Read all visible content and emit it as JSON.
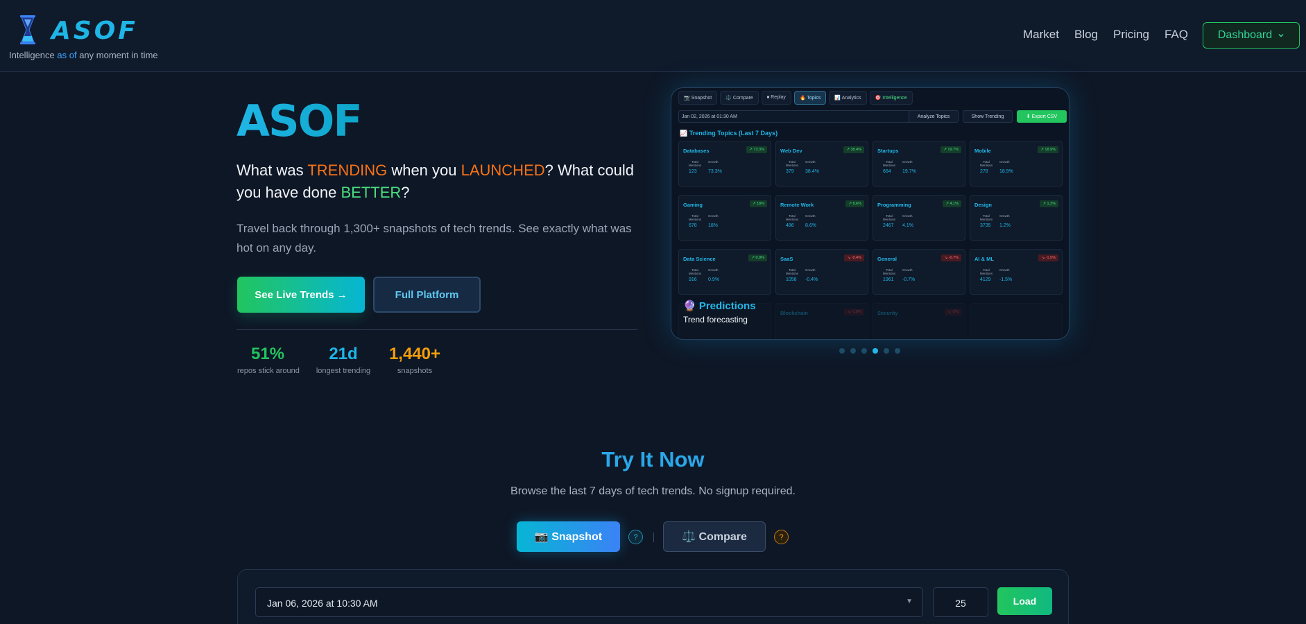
{
  "nav": {
    "brand": "ASOF",
    "tagline_pre": "Intelligence ",
    "tagline_hl": "as of",
    "tagline_post": " any moment in time",
    "links": [
      "Market",
      "Blog",
      "Pricing",
      "FAQ"
    ],
    "dashboard_label": "Dashboard"
  },
  "hero": {
    "title": "ASOF",
    "q_part1": "What was ",
    "q_trending": "TRENDING",
    "q_part2": " when you ",
    "q_launched": "LAUNCHED",
    "q_part3": "? What could you have done ",
    "q_better": "BETTER",
    "q_part4": "?",
    "subtitle": "Travel back through 1,300+ snapshots of tech trends. See exactly what was hot on any day.",
    "btn_live": "See Live Trends →",
    "btn_full": "Full Platform",
    "stats": [
      {
        "value": "51%",
        "label": "repos stick around",
        "color": "#22c55e"
      },
      {
        "value": "21d",
        "label": "longest trending",
        "color": "#1fb6e6"
      },
      {
        "value": "1,440+",
        "label": "snapshots",
        "color": "#f59e0b"
      }
    ]
  },
  "preview": {
    "tabs": [
      "📷 Snapshot",
      "⚖️ Compare",
      "⏹ Replay",
      "🔥 Topics",
      "📊 Analytics",
      "🎯 Intelligence"
    ],
    "active_tab": 3,
    "date": "Jan 02, 2026 at 01:30 AM",
    "btn_analyze": "Analyze Topics",
    "btn_trending": "Show Trending",
    "btn_export": "⬇ Export CSV",
    "heading": "📈 Trending Topics (Last 7 Days)",
    "mentions_label": "Total Mentions",
    "growth_label": "Growth",
    "cards": [
      {
        "name": "Databases",
        "badge": "↗ 73.3%",
        "dir": "up",
        "mentions": "123",
        "growth": "73.3%"
      },
      {
        "name": "Web Dev",
        "badge": "↗ 38.4%",
        "dir": "up",
        "mentions": "379",
        "growth": "38.4%"
      },
      {
        "name": "Startups",
        "badge": "↗ 19.7%",
        "dir": "up",
        "mentions": "664",
        "growth": "19.7%"
      },
      {
        "name": "Mobile",
        "badge": "↗ 18.9%",
        "dir": "up",
        "mentions": "278",
        "growth": "18.9%"
      },
      {
        "name": "Gaming",
        "badge": "↗ 18%",
        "dir": "up",
        "mentions": "678",
        "growth": "18%"
      },
      {
        "name": "Remote Work",
        "badge": "↗ 8.6%",
        "dir": "up",
        "mentions": "486",
        "growth": "8.6%"
      },
      {
        "name": "Programming",
        "badge": "↗ 4.1%",
        "dir": "up",
        "mentions": "2467",
        "growth": "4.1%"
      },
      {
        "name": "Design",
        "badge": "↗ 1.2%",
        "dir": "up",
        "mentions": "3735",
        "growth": "1.2%"
      },
      {
        "name": "Data Science",
        "badge": "↗ 0.9%",
        "dir": "up",
        "mentions": "916",
        "growth": "0.9%"
      },
      {
        "name": "SaaS",
        "badge": "↘ -0.4%",
        "dir": "down",
        "mentions": "1058",
        "growth": "-0.4%"
      },
      {
        "name": "General",
        "badge": "↘ -0.7%",
        "dir": "down",
        "mentions": "1961",
        "growth": "-0.7%"
      },
      {
        "name": "AI & ML",
        "badge": "↘ -1.5%",
        "dir": "down",
        "mentions": "4129",
        "growth": "-1.5%"
      },
      {
        "name": "",
        "badge": "",
        "dir": "up",
        "mentions": "",
        "growth": ""
      },
      {
        "name": "Blockchain",
        "badge": "↘ -1.8%",
        "dir": "down",
        "mentions": "",
        "growth": ""
      },
      {
        "name": "Security",
        "badge": "↘ -2%",
        "dir": "down",
        "mentions": "",
        "growth": ""
      },
      {
        "name": "",
        "badge": "",
        "dir": "up",
        "mentions": "",
        "growth": ""
      }
    ],
    "caption_title": "🔮 Predictions",
    "caption_sub": "Trend forecasting",
    "dots": 6,
    "active_dot": 3
  },
  "try": {
    "title": "Try It Now",
    "subtitle": "Browse the last 7 days of tech trends. No signup required.",
    "snapshot_label": "📷 Snapshot",
    "compare_label": "⚖️ Compare",
    "help_label": "?",
    "date_value": "Jan 06, 2026 at 10:30 AM",
    "count_value": "25",
    "load_label": "Load"
  },
  "colors": {
    "accent": "#1fb6e6",
    "green": "#22c55e",
    "orange": "#f97316",
    "background": "#0e1726"
  }
}
